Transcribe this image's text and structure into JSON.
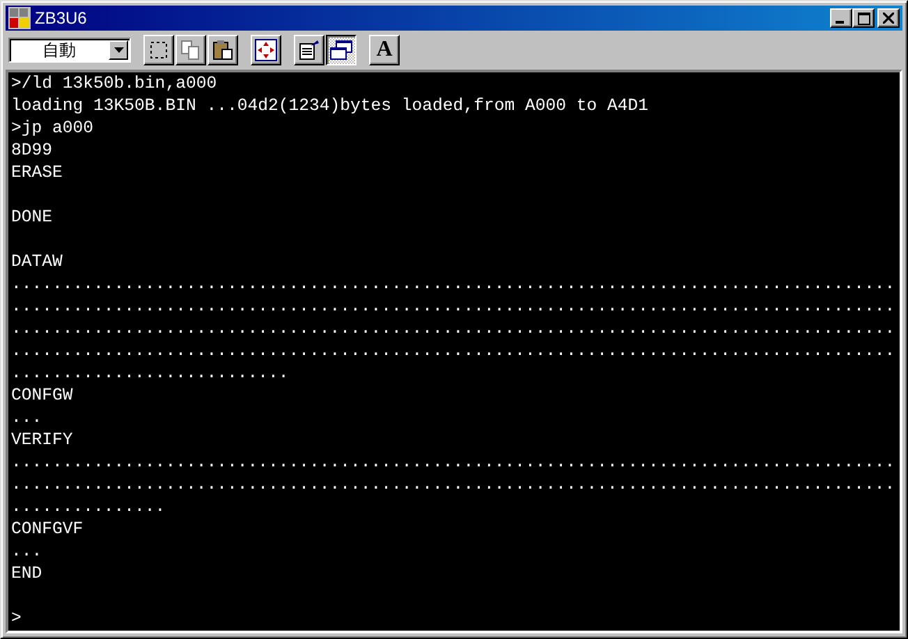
{
  "window": {
    "title": "ZB3U6"
  },
  "toolbar": {
    "mode_select": {
      "value": "自動"
    },
    "button_groups": [
      [
        {
          "kind": "select",
          "selected": false
        },
        {
          "kind": "copy",
          "selected": false
        },
        {
          "kind": "paste",
          "selected": false
        }
      ],
      [
        {
          "kind": "move",
          "selected": false
        }
      ],
      [
        {
          "kind": "properties",
          "selected": false
        },
        {
          "kind": "windows",
          "selected": true
        }
      ],
      [
        {
          "kind": "font",
          "label": "A",
          "selected": false
        }
      ]
    ]
  },
  "terminal": {
    "lines": [
      {
        "text": ">/ld 13k50b.bin,a000",
        "blank_before": false
      },
      {
        "text": "loading 13K50B.BIN ...04d2(1234)bytes loaded,from A000 to A4D1",
        "blank_before": false
      },
      {
        "text": ">jp a000",
        "blank_before": false
      },
      {
        "text": "8D99",
        "blank_before": false
      },
      {
        "text": "ERASE",
        "blank_before": false
      },
      {
        "text": "DONE",
        "blank_before": true
      },
      {
        "text": "DATAW",
        "blank_before": true
      },
      {
        "text": "......................................................................................",
        "blank_before": false
      },
      {
        "text": "......................................................................................",
        "blank_before": false
      },
      {
        "text": "......................................................................................",
        "blank_before": false
      },
      {
        "text": "......................................................................................",
        "blank_before": false
      },
      {
        "text": "...........................",
        "blank_before": false
      },
      {
        "text": "CONFGW",
        "blank_before": false
      },
      {
        "text": "...",
        "blank_before": false
      },
      {
        "text": "VERIFY",
        "blank_before": false
      },
      {
        "text": "......................................................................................",
        "blank_before": false
      },
      {
        "text": "......................................................................................",
        "blank_before": false
      },
      {
        "text": "...............",
        "blank_before": false
      },
      {
        "text": "CONFGVF",
        "blank_before": false
      },
      {
        "text": "...",
        "blank_before": false
      },
      {
        "text": "END",
        "blank_before": false
      },
      {
        "text": ">",
        "blank_before": true
      }
    ]
  }
}
